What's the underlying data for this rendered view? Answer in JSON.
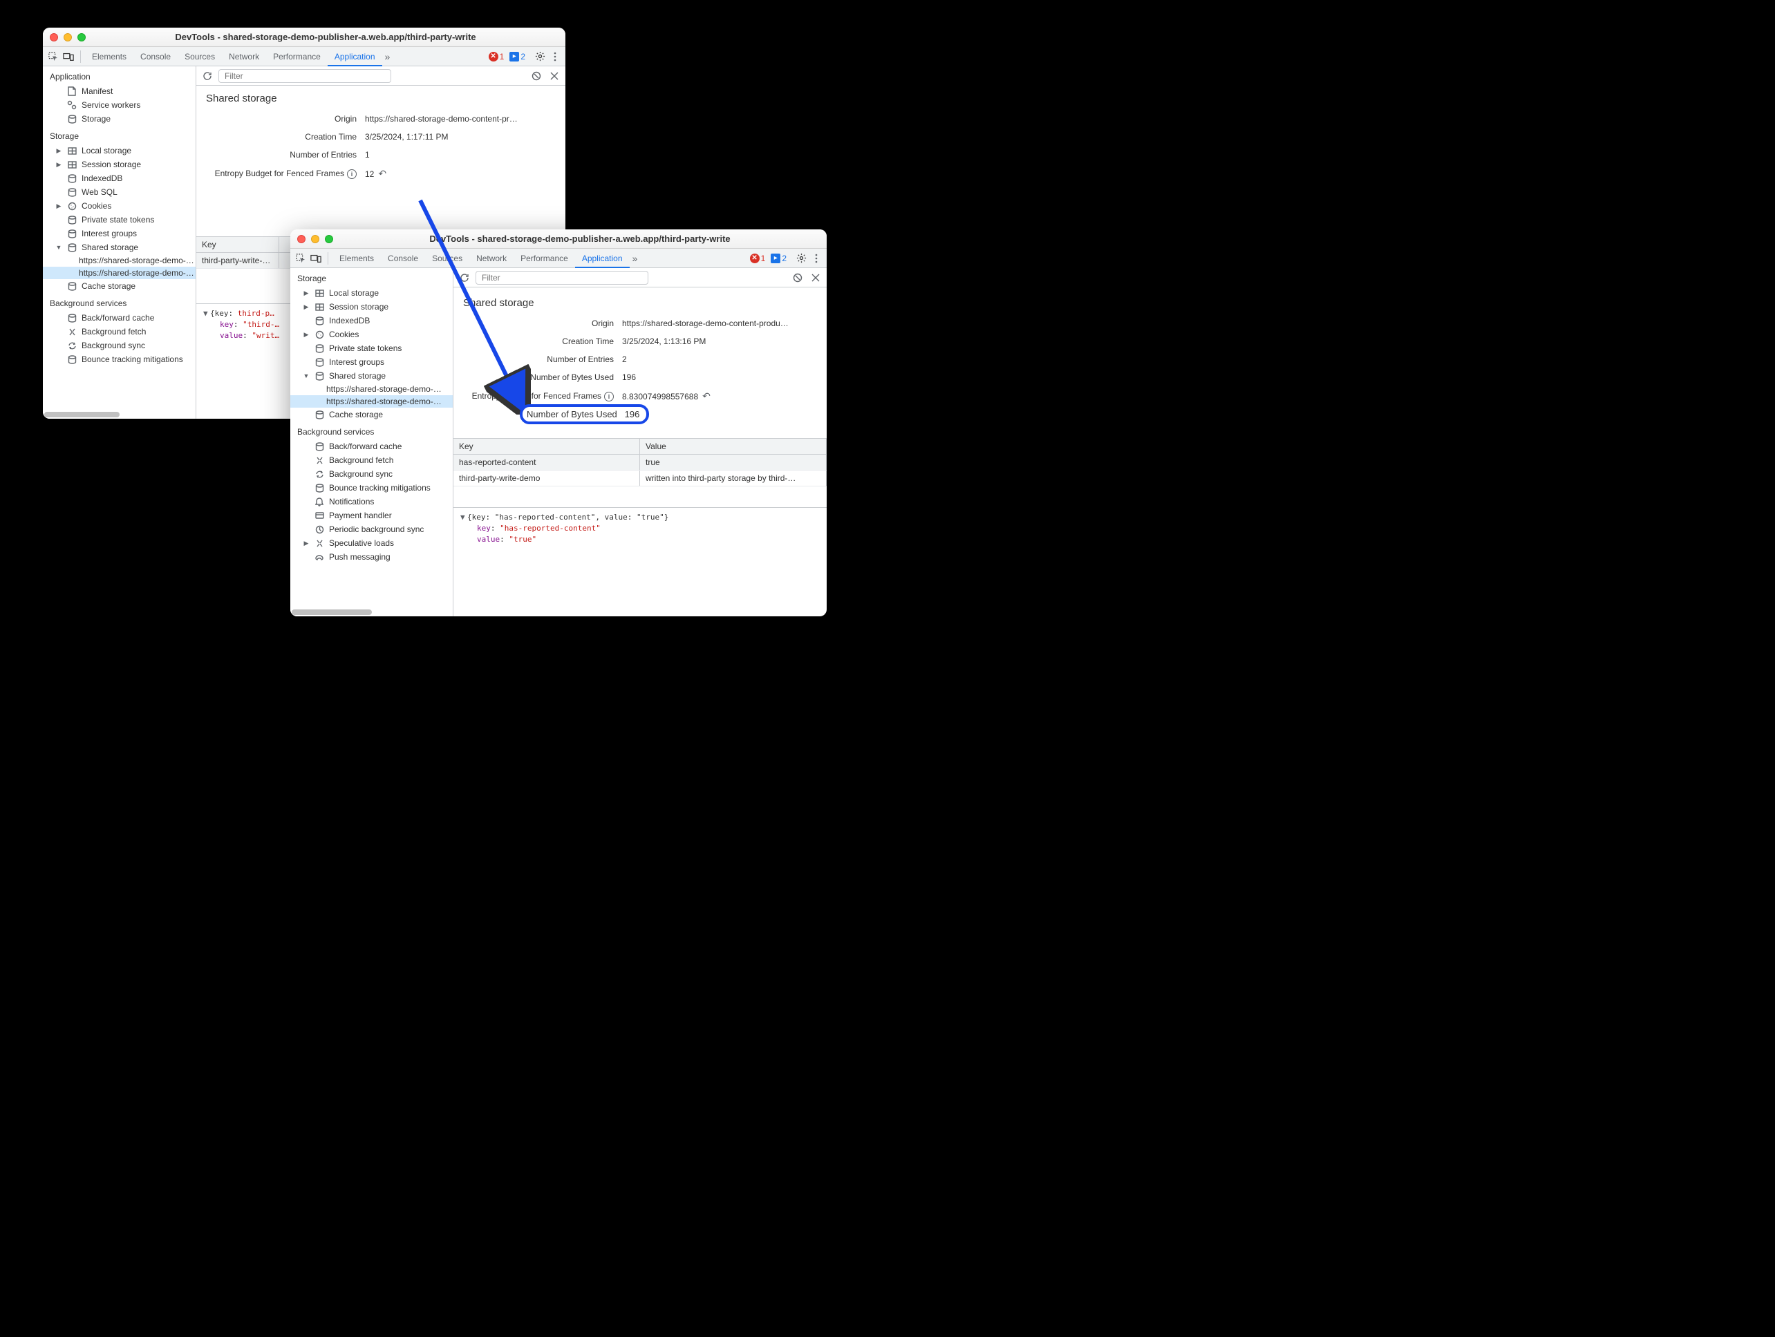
{
  "windowA": {
    "title": "DevTools - shared-storage-demo-publisher-a.web.app/third-party-write",
    "tabs": [
      "Elements",
      "Console",
      "Sources",
      "Network",
      "Performance",
      "Application"
    ],
    "activeTab": "Application",
    "errCount": "1",
    "msgCount": "2",
    "filterPlaceholder": "Filter",
    "sidebar": {
      "application": {
        "heading": "Application",
        "items": [
          "Manifest",
          "Service workers",
          "Storage"
        ]
      },
      "storage": {
        "heading": "Storage",
        "items": [
          "Local storage",
          "Session storage",
          "IndexedDB",
          "Web SQL",
          "Cookies",
          "Private state tokens",
          "Interest groups",
          "Shared storage"
        ],
        "sharedChildren": [
          "https://shared-storage-demo-…",
          "https://shared-storage-demo-…"
        ],
        "cache": "Cache storage"
      },
      "bg": {
        "heading": "Background services",
        "items": [
          "Back/forward cache",
          "Background fetch",
          "Background sync",
          "Bounce tracking mitigations"
        ]
      }
    },
    "panel": {
      "heading": "Shared storage",
      "rows": [
        {
          "label": "Origin",
          "value": "https://shared-storage-demo-content-pr…"
        },
        {
          "label": "Creation Time",
          "value": "3/25/2024, 1:17:11 PM"
        },
        {
          "label": "Number of Entries",
          "value": "1"
        },
        {
          "label": "Entropy Budget for Fenced Frames",
          "value": "12",
          "info": true,
          "undo": true
        }
      ],
      "table": {
        "headKey": "Key",
        "rowKey": "third-party-write-d…"
      },
      "obj": {
        "key": "third-p…",
        "krow": "third-…",
        "vrow": "writ…"
      }
    }
  },
  "windowB": {
    "title": "DevTools - shared-storage-demo-publisher-a.web.app/third-party-write",
    "tabs": [
      "Elements",
      "Console",
      "Sources",
      "Network",
      "Performance",
      "Application"
    ],
    "activeTab": "Application",
    "errCount": "1",
    "msgCount": "2",
    "filterPlaceholder": "Filter",
    "sidebar": {
      "storage": {
        "heading": "Storage",
        "items": [
          "Local storage",
          "Session storage",
          "IndexedDB",
          "Cookies",
          "Private state tokens",
          "Interest groups",
          "Shared storage"
        ],
        "sharedChildren": [
          "https://shared-storage-demo-…",
          "https://shared-storage-demo-…"
        ],
        "cache": "Cache storage"
      },
      "bg": {
        "heading": "Background services",
        "items": [
          "Back/forward cache",
          "Background fetch",
          "Background sync",
          "Bounce tracking mitigations",
          "Notifications",
          "Payment handler",
          "Periodic background sync",
          "Speculative loads",
          "Push messaging"
        ]
      }
    },
    "panel": {
      "heading": "Shared storage",
      "rows": [
        {
          "label": "Origin",
          "value": "https://shared-storage-demo-content-produ…"
        },
        {
          "label": "Creation Time",
          "value": "3/25/2024, 1:13:16 PM"
        },
        {
          "label": "Number of Entries",
          "value": "2"
        },
        {
          "label": "Number of Bytes Used",
          "value": "196"
        },
        {
          "label": "Entropy Budget for Fenced Frames",
          "value": "8.830074998557688",
          "info": true,
          "undo": true
        }
      ],
      "table": {
        "headKey": "Key",
        "headVal": "Value",
        "rows": [
          {
            "k": "has-reported-content",
            "v": "true"
          },
          {
            "k": "third-party-write-demo",
            "v": "written into third-party storage by third-…"
          }
        ]
      },
      "obj": {
        "line": "{key: \"has-reported-content\", value: \"true\"}",
        "krow": "has-reported-content",
        "vrow": "true"
      }
    }
  },
  "callout": {
    "label": "Number of Bytes Used",
    "value": "196"
  }
}
